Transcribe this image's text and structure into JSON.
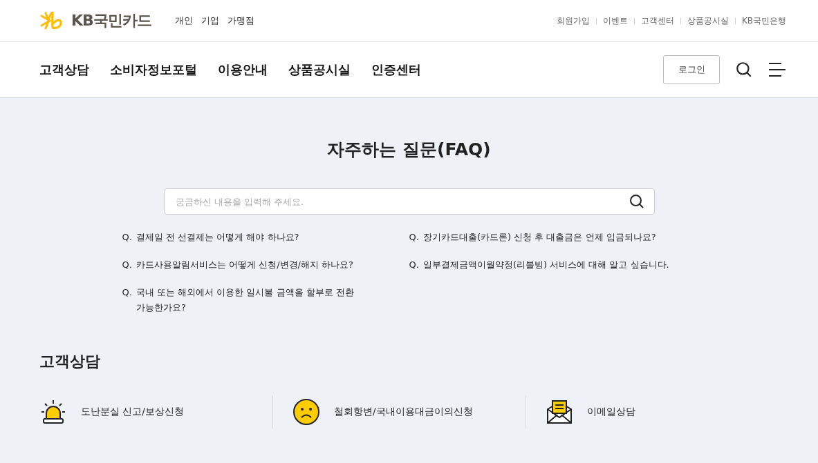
{
  "logo": {
    "text": "KB국민카드"
  },
  "top_links": [
    "개인",
    "기업",
    "가맹점"
  ],
  "util_links": [
    "회원가입",
    "이벤트",
    "고객센터",
    "상품공시실",
    "KB국민은행"
  ],
  "main_nav": [
    "고객상담",
    "소비자정보포털",
    "이용안내",
    "상품공시실",
    "인증센터"
  ],
  "login_button": "로그인",
  "page_title": "자주하는 질문(FAQ)",
  "search": {
    "placeholder": "궁금하신 내용을 입력해 주세요."
  },
  "faq": [
    {
      "mark": "Q.",
      "text": "결제일 전 선결제는 어떻게 해야 하나요?"
    },
    {
      "mark": "Q.",
      "text": "장기카드대출(카드론) 신청 후 대출금은 언제 입금되나요?"
    },
    {
      "mark": "Q.",
      "text": "카드사용알림서비스는 어떻게 신청/변경/해지 하나요?"
    },
    {
      "mark": "Q.",
      "text": "일부결제금액이월약정(리볼빙) 서비스에 대해 알고 싶습니다."
    },
    {
      "mark": "Q.",
      "text": "국내 또는 해외에서 이용한 일시불 금액을 할부로 전환 가능한가요?"
    }
  ],
  "section_title": "고객상담",
  "services": [
    {
      "kind": "siren",
      "label": "도난분실 신고/보상신청"
    },
    {
      "kind": "sad",
      "label": "철회항변/국내이용대금이의신청"
    },
    {
      "kind": "mail",
      "label": "이메일상담"
    }
  ]
}
